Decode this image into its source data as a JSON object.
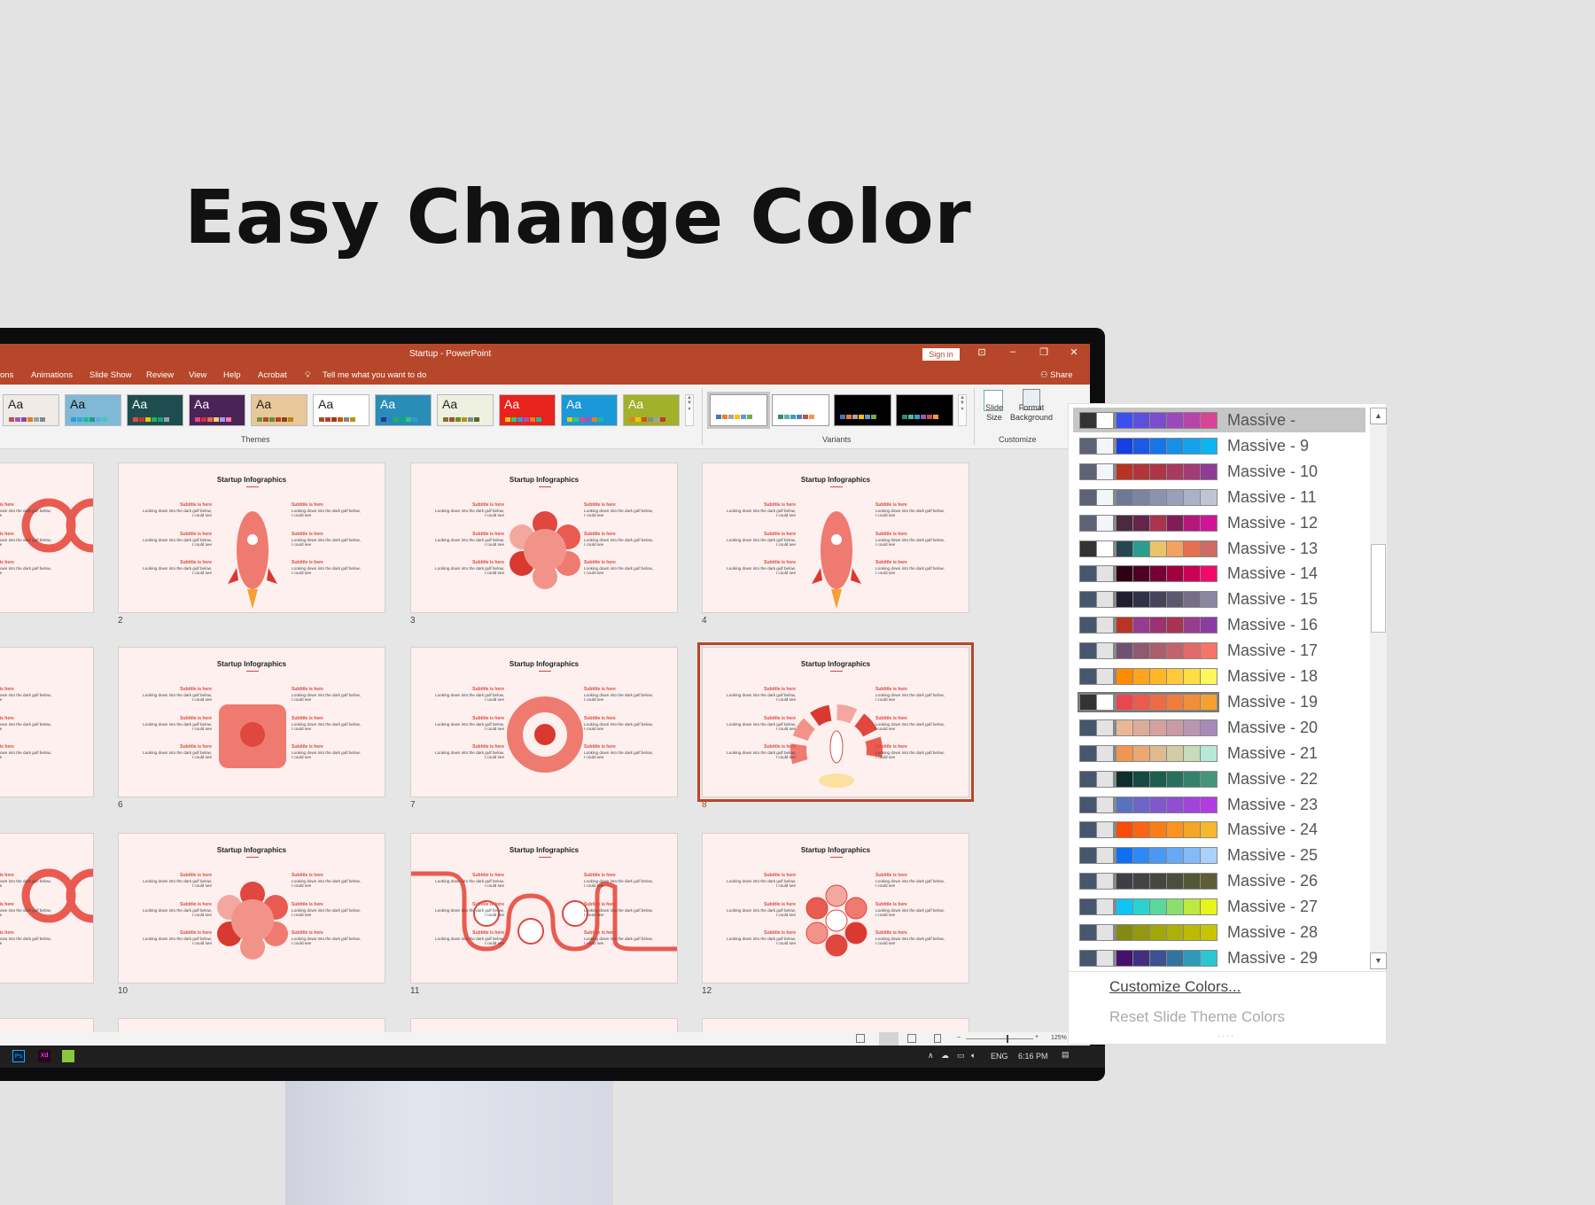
{
  "headline": "Easy Change Color",
  "window": {
    "title": "Startup  -  PowerPoint",
    "sign_in": "Sign in",
    "share": "Share",
    "accent": "#b7472a"
  },
  "tabs": [
    "ons",
    "Animations",
    "Slide Show",
    "Review",
    "View",
    "Help",
    "Acrobat"
  ],
  "tell_me": "Tell me what you want to do",
  "ribbon": {
    "themes_label": "Themes",
    "variants_label": "Variants",
    "customize_label": "Customize",
    "slide_size": "Slide Size",
    "format_background": "Format Background",
    "themes": [
      {
        "aa": "Aa",
        "bg": "#f1ebe8",
        "fg": "#222",
        "sw": [
          "#c0504d",
          "#9b59b6",
          "#8e44ad",
          "#e67e22",
          "#95a5a6",
          "#7f8c8d"
        ]
      },
      {
        "aa": "Aa",
        "bg": "#7fb9d6",
        "fg": "#111",
        "sw": [
          "#3498db",
          "#2eaadc",
          "#1abc9c",
          "#16a085",
          "#5dade2",
          "#48c9b0"
        ]
      },
      {
        "aa": "Aa",
        "bg": "#1f4d4f",
        "fg": "#fff",
        "sw": [
          "#e74c3c",
          "#c0392b",
          "#f1c40f",
          "#27ae60",
          "#16a085",
          "#95a5a6"
        ]
      },
      {
        "aa": "Aa",
        "bg": "#4a2456",
        "fg": "#fff",
        "sw": [
          "#e84393",
          "#d63031",
          "#e17055",
          "#fdcb6e",
          "#a29bfe",
          "#fd79a8"
        ]
      },
      {
        "aa": "Aa",
        "bg": "#e6c89a",
        "fg": "#222",
        "sw": [
          "#7f8c3a",
          "#a0522d",
          "#6b8e23",
          "#c0392b",
          "#8b4513",
          "#b8860b"
        ]
      },
      {
        "aa": "Aa",
        "bg": "#ffffff",
        "fg": "#222",
        "sw": [
          "#a0522d",
          "#c0392b",
          "#8b4513",
          "#d35400",
          "#7f8c8d",
          "#b7950b"
        ]
      },
      {
        "aa": "Aa",
        "bg": "#2a8db8",
        "fg": "#fff",
        "sw": [
          "#1f3a93",
          "#2c82c9",
          "#27ae60",
          "#16a085",
          "#2ecc71",
          "#3498db"
        ]
      },
      {
        "aa": "Aa",
        "bg": "#eef0e0",
        "fg": "#222",
        "sw": [
          "#8e6b3a",
          "#a0522d",
          "#6b8e23",
          "#b7950b",
          "#7f8c8d",
          "#556b2f"
        ]
      },
      {
        "aa": "Aa",
        "bg": "#e8221c",
        "fg": "#fff",
        "sw": [
          "#f1c40f",
          "#2ecc71",
          "#3498db",
          "#9b59b6",
          "#e67e22",
          "#1abc9c"
        ]
      },
      {
        "aa": "Aa",
        "bg": "#1a98d8",
        "fg": "#fff",
        "sw": [
          "#f1c40f",
          "#2ecc71",
          "#e84393",
          "#9b59b6",
          "#e67e22",
          "#1abc9c"
        ]
      },
      {
        "aa": "Aa",
        "bg": "#a2b02a",
        "fg": "#fff",
        "sw": [
          "#e67e22",
          "#f1c40f",
          "#d35400",
          "#7f8c8d",
          "#95a5a6",
          "#c0392b"
        ]
      }
    ],
    "variants": [
      {
        "bg": "#ffffff",
        "sw": [
          "#4472c4",
          "#ed7d31",
          "#a5a5a5",
          "#ffc000",
          "#5b9bd5",
          "#70ad47"
        ]
      },
      {
        "bg": "#ffffff",
        "sw": [
          "#2e8b7a",
          "#5fb0a0",
          "#3aa0c0",
          "#4f81bd",
          "#c0504d",
          "#f79646"
        ]
      },
      {
        "bg": "#000000",
        "sw": [
          "#4472c4",
          "#ed7d31",
          "#a5a5a5",
          "#ffc000",
          "#5b9bd5",
          "#70ad47"
        ]
      },
      {
        "bg": "#000000",
        "sw": [
          "#2e8b7a",
          "#5fb0a0",
          "#3aa0c0",
          "#9b59b6",
          "#c0504d",
          "#f79646"
        ]
      }
    ]
  },
  "slide_text": {
    "title": "Startup Infographics",
    "subtitle": "Subtitle is here",
    "body": "Looking down into the dark gulf below, I could see"
  },
  "slides": [
    {
      "n": "",
      "col": 0,
      "row": 0,
      "type": "loop"
    },
    {
      "n": "2",
      "col": 1,
      "row": 0,
      "type": "rocket"
    },
    {
      "n": "3",
      "col": 2,
      "row": 0,
      "type": "flower"
    },
    {
      "n": "4",
      "col": 3,
      "row": 0,
      "type": "rocket"
    },
    {
      "n": "",
      "col": 0,
      "row": 1,
      "type": "none"
    },
    {
      "n": "6",
      "col": 1,
      "row": 1,
      "type": "puzzle"
    },
    {
      "n": "7",
      "col": 2,
      "row": 1,
      "type": "ring"
    },
    {
      "n": "8",
      "col": 3,
      "row": 1,
      "type": "arc",
      "selected": true
    },
    {
      "n": "",
      "col": 0,
      "row": 2,
      "type": "loop"
    },
    {
      "n": "10",
      "col": 1,
      "row": 2,
      "type": "flower"
    },
    {
      "n": "11",
      "col": 2,
      "row": 2,
      "type": "path"
    },
    {
      "n": "12",
      "col": 3,
      "row": 2,
      "type": "hex"
    }
  ],
  "statusbar": {
    "zoom": "125%"
  },
  "taskbar": {
    "apps": [
      "Ps",
      "Xd",
      ""
    ],
    "lang": "ENG",
    "time": "6:16 PM"
  },
  "colors_menu": {
    "palettes": [
      {
        "name": "Massive -",
        "selected": true,
        "colors": [
          "#333333",
          "#ffffff",
          "#3d4ef0",
          "#5c4fdc",
          "#7b4ccb",
          "#9b48bb",
          "#b744a8",
          "#d84596"
        ]
      },
      {
        "name": "Massive -  9",
        "colors": [
          "#5d6274",
          "#f3f5fa",
          "#1540e0",
          "#1a5ae6",
          "#1675e8",
          "#168fe8",
          "#12a2ee",
          "#0bb5f0"
        ]
      },
      {
        "name": "Massive - 10",
        "colors": [
          "#5d6274",
          "#f3f5fa",
          "#b93226",
          "#b3353b",
          "#ad3548",
          "#a83a5e",
          "#a13c76",
          "#8f3c94"
        ]
      },
      {
        "name": "Massive - 11",
        "colors": [
          "#5d6274",
          "#f3f5fa",
          "#6f7896",
          "#7c84a2",
          "#8b93ae",
          "#9aa0ba",
          "#aab1c8",
          "#c0c5d6"
        ]
      },
      {
        "name": "Massive - 12",
        "colors": [
          "#5d6274",
          "#f3f5fa",
          "#4a2a3c",
          "#65254a",
          "#a8344d",
          "#7e1d5a",
          "#b5187a",
          "#cf1494"
        ]
      },
      {
        "name": "Massive - 13",
        "colors": [
          "#333333",
          "#ffffff",
          "#264653",
          "#2a9d8f",
          "#e9c46a",
          "#f4a261",
          "#e76f51",
          "#cd6b64"
        ]
      },
      {
        "name": "Massive - 14",
        "colors": [
          "#45566e",
          "#e3e3e3",
          "#2e0014",
          "#4d0024",
          "#760036",
          "#a3003f",
          "#cc0054",
          "#f00b68"
        ]
      },
      {
        "name": "Massive - 15",
        "colors": [
          "#45566e",
          "#e3e3e3",
          "#201d2e",
          "#33304a",
          "#47435c",
          "#5d5870",
          "#746e89",
          "#8b85a2"
        ]
      },
      {
        "name": "Massive - 16",
        "colors": [
          "#45566e",
          "#e3e3e3",
          "#b83526",
          "#963b8e",
          "#9c3270",
          "#a63452",
          "#973d8e",
          "#8b3ca0"
        ]
      },
      {
        "name": "Massive - 17",
        "colors": [
          "#45566e",
          "#e3e3e3",
          "#6f5272",
          "#8e5a70",
          "#a85f6e",
          "#c2626c",
          "#e06a6a",
          "#f77568"
        ]
      },
      {
        "name": "Massive - 18",
        "colors": [
          "#45566e",
          "#e3e3e3",
          "#ff8c00",
          "#ffa41c",
          "#ffb726",
          "#ffc93a",
          "#ffde44",
          "#fcf85c"
        ]
      },
      {
        "name": "Massive - 19",
        "hover": true,
        "colors": [
          "#333333",
          "#ffffff",
          "#e9474f",
          "#eb5a4a",
          "#ed6b44",
          "#f07d3e",
          "#f38e38",
          "#f5a030"
        ]
      },
      {
        "name": "Massive - 20",
        "colors": [
          "#45566e",
          "#e3e3e3",
          "#e7b796",
          "#dcac9b",
          "#d3a2a0",
          "#c89ba8",
          "#b997b0",
          "#a68ab8"
        ]
      },
      {
        "name": "Massive - 21",
        "colors": [
          "#45566e",
          "#e3e3e3",
          "#f29553",
          "#eaa873",
          "#deba8d",
          "#d3cca4",
          "#c8dbbb",
          "#b6ead6"
        ]
      },
      {
        "name": "Massive - 22",
        "colors": [
          "#45566e",
          "#e3e3e3",
          "#0d2e2a",
          "#154a40",
          "#1d5d4e",
          "#286f5e",
          "#34816c",
          "#45957c"
        ]
      },
      {
        "name": "Massive - 23",
        "colors": [
          "#45566e",
          "#e3e3e3",
          "#5872c0",
          "#6d65c7",
          "#7f59ca",
          "#8e4fd2",
          "#a044da",
          "#b23be2"
        ]
      },
      {
        "name": "Massive - 24",
        "colors": [
          "#45566e",
          "#e3e3e3",
          "#f84c0a",
          "#fb6410",
          "#fb7d16",
          "#fa9320",
          "#f8a424",
          "#f6b92c"
        ]
      },
      {
        "name": "Massive - 25",
        "colors": [
          "#45566e",
          "#e3e3e3",
          "#0d6ff2",
          "#2e88f5",
          "#4a98f6",
          "#66a9f7",
          "#82bbf9",
          "#a9d2fb"
        ]
      },
      {
        "name": "Massive - 26",
        "colors": [
          "#45566e",
          "#e3e3e3",
          "#3e3f46",
          "#414440",
          "#45483e",
          "#4a4e3c",
          "#545638",
          "#5d5e36"
        ]
      },
      {
        "name": "Massive - 27",
        "colors": [
          "#45566e",
          "#e3e3e3",
          "#0dc6f6",
          "#2ad3cf",
          "#5ad89c",
          "#8be06d",
          "#bde941",
          "#e6f51c"
        ]
      },
      {
        "name": "Massive - 28",
        "colors": [
          "#45566e",
          "#e3e3e3",
          "#828a10",
          "#92990e",
          "#a0a70c",
          "#adb00a",
          "#bbbb06",
          "#c8c404"
        ]
      },
      {
        "name": "Massive - 29",
        "colors": [
          "#45566e",
          "#e3e3e3",
          "#46116b",
          "#42307f",
          "#3c5291",
          "#33749f",
          "#2d9ab8",
          "#2ac6d2"
        ]
      }
    ],
    "customize": "Customize Colors...",
    "reset": "Reset Slide Theme Colors"
  }
}
